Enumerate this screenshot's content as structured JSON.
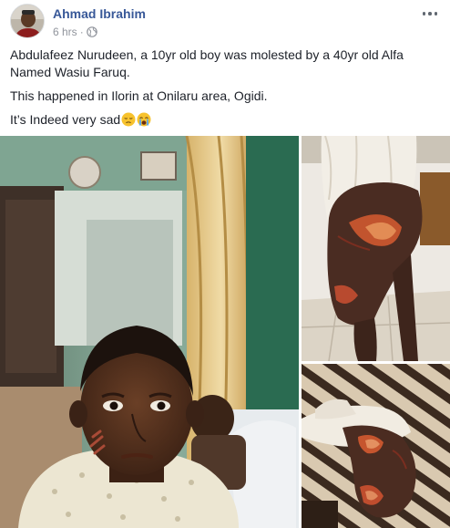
{
  "post": {
    "author": "Ahmad Ibrahim",
    "timestamp": "6 hrs",
    "separator": "·",
    "privacy_icon": "globe-icon",
    "more_icon": "more-options-icon",
    "lines": [
      "Abdulafeez Nurudeen, a 10yr old boy was molested by a 40yr old Alfa Named Wasiu Faruq.",
      "This happened in Ilorin at Onilaru area, Ogidi.",
      "It’s Indeed very sad"
    ],
    "emojis": [
      "pensive-face-icon",
      "crying-face-icon"
    ]
  },
  "colors": {
    "author_link": "#385898",
    "meta_text": "#90949c",
    "body_text": "#1d2129"
  }
}
